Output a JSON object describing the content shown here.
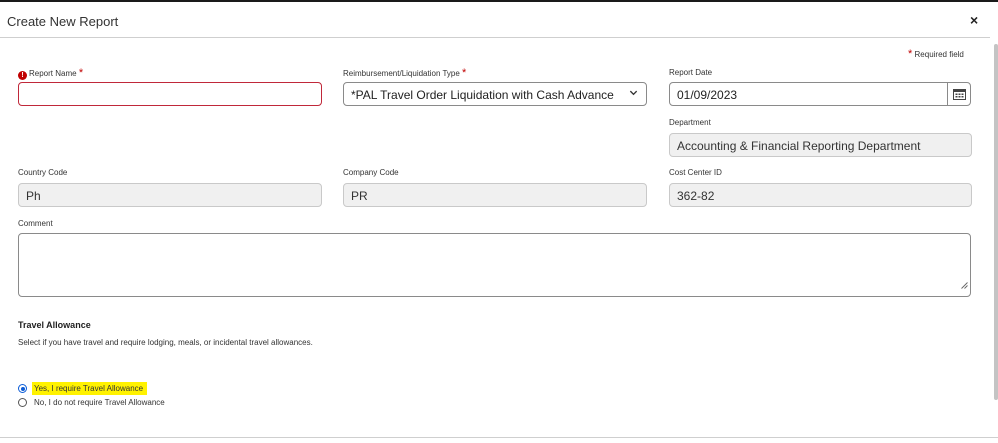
{
  "dialog": {
    "title": "Create New Report",
    "close_symbol": "×",
    "required_note": "Required field",
    "required_marker": "*"
  },
  "fields": {
    "report_name": {
      "label": "Report Name",
      "value": "",
      "error_icon": "!"
    },
    "reimbursement_type": {
      "label": "Reimbursement/Liquidation Type",
      "value": "*PAL Travel Order Liquidation with Cash Advance"
    },
    "report_date": {
      "label": "Report Date",
      "value": "01/09/2023"
    },
    "department": {
      "label": "Department",
      "value": "Accounting & Financial Reporting Department"
    },
    "country_code": {
      "label": "Country Code",
      "value": "Ph"
    },
    "company_code": {
      "label": "Company Code",
      "value": "PR"
    },
    "cost_center": {
      "label": "Cost Center ID",
      "value": "362-82"
    },
    "comment": {
      "label": "Comment",
      "value": ""
    }
  },
  "travel_allowance": {
    "heading": "Travel Allowance",
    "description": "Select if you have travel and require lodging, meals, or incidental travel allowances.",
    "options": [
      {
        "label": "Yes, I require Travel Allowance",
        "selected": true
      },
      {
        "label": "No, I do not require Travel Allowance",
        "selected": false
      }
    ]
  },
  "icons": {
    "close": "close-icon",
    "error": "error-icon",
    "dropdown": "chevron-down-icon",
    "calendar": "calendar-icon",
    "resize": "resize-grip-icon"
  },
  "colors": {
    "required": "#c00000",
    "error_border": "#c0283a",
    "radio_selected": "#0b5cd6",
    "highlight": "#fff200",
    "readonly_bg": "#f0f0f0"
  }
}
